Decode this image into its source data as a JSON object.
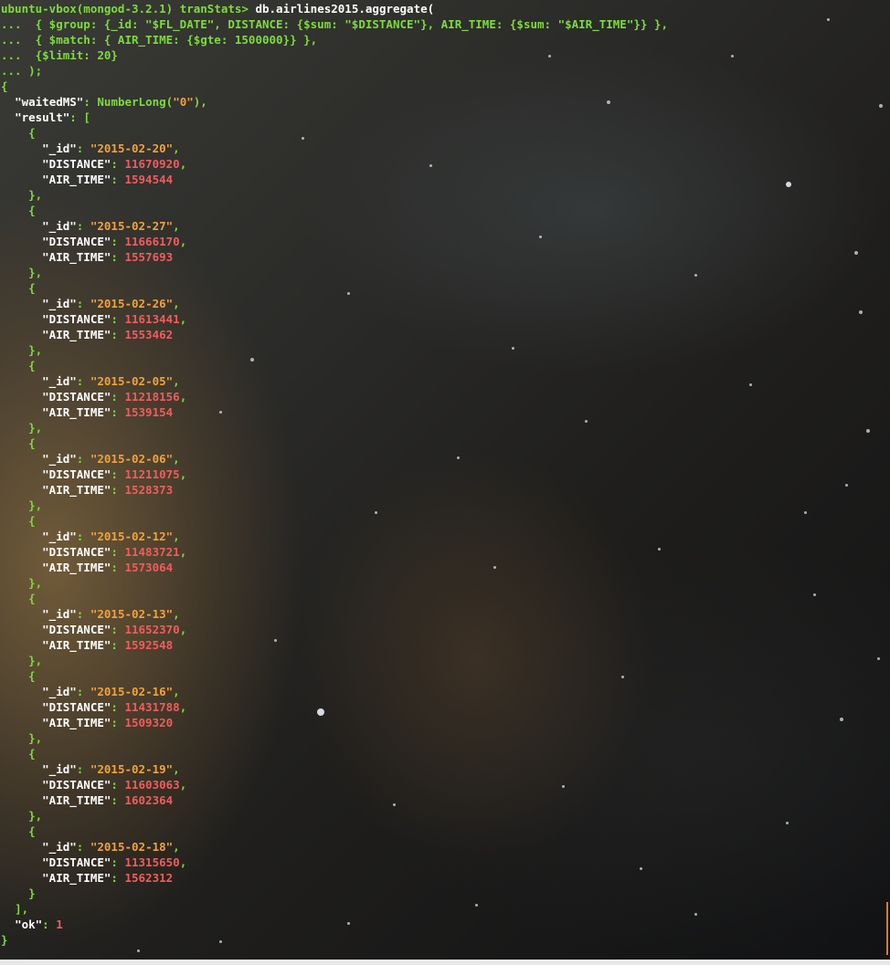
{
  "prompt": {
    "host": "ubuntu-vbox(mongod-3.2.1)",
    "db": "tranStats>",
    "command": " db.airlines2015.aggregate("
  },
  "continuation": {
    "marker": "...",
    "line1": "  { $group: {_id: \"$FL_DATE\", DISTANCE: {$sum: \"$DISTANCE\"}, AIR_TIME: {$sum: \"$AIR_TIME\"}} },",
    "line2": "  { $match: { AIR_TIME: {$gte: 1500000}} },",
    "line3": "  {$limit: 20}",
    "line4": " );"
  },
  "output": {
    "open_brace": "{",
    "waited_key": "\"waitedMS\"",
    "waited_func": "NumberLong(",
    "waited_val": "\"0\"",
    "waited_close": "),",
    "result_key": "\"result\"",
    "result_open": "[",
    "id_key": "\"_id\"",
    "distance_key": "\"DISTANCE\"",
    "air_time_key": "\"AIR_TIME\"",
    "records": [
      {
        "id": "\"2015-02-20\"",
        "distance": "11670920",
        "air_time": "1594544"
      },
      {
        "id": "\"2015-02-27\"",
        "distance": "11666170",
        "air_time": "1557693"
      },
      {
        "id": "\"2015-02-26\"",
        "distance": "11613441",
        "air_time": "1553462"
      },
      {
        "id": "\"2015-02-05\"",
        "distance": "11218156",
        "air_time": "1539154"
      },
      {
        "id": "\"2015-02-06\"",
        "distance": "11211075",
        "air_time": "1528373"
      },
      {
        "id": "\"2015-02-12\"",
        "distance": "11483721",
        "air_time": "1573064"
      },
      {
        "id": "\"2015-02-13\"",
        "distance": "11652370",
        "air_time": "1592548"
      },
      {
        "id": "\"2015-02-16\"",
        "distance": "11431788",
        "air_time": "1509320"
      },
      {
        "id": "\"2015-02-19\"",
        "distance": "11603063",
        "air_time": "1602364"
      },
      {
        "id": "\"2015-02-18\"",
        "distance": "11315650",
        "air_time": "1562312"
      }
    ],
    "result_close": "],",
    "ok_key": "\"ok\"",
    "ok_val": "1",
    "close_brace": "}"
  },
  "colors": {
    "prompt": "#7ddc3a",
    "key": "#ffffff",
    "string": "#f2a23b",
    "number": "#ef5d5d"
  }
}
